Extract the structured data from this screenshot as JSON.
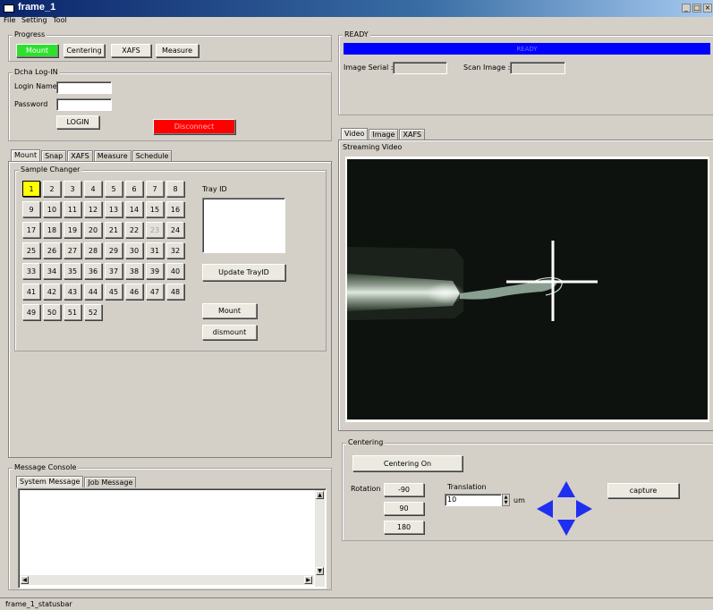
{
  "window": {
    "title": "frame_1",
    "minimize": "_",
    "maximize": "□",
    "close": "×"
  },
  "menu": [
    "File",
    "Setting",
    "Tool"
  ],
  "progress": {
    "legend": "Progress",
    "steps": [
      "Mount",
      "Centering",
      "XAFS",
      "Measure"
    ],
    "active_color": "#2ee02e"
  },
  "login": {
    "legend": "Dcha Log-IN",
    "login_name_label": "Login Name",
    "password_label": "Password",
    "login_value": "",
    "password_value": "",
    "login_button": "LOGIN",
    "disconnect_button": "Disconnect",
    "disconnect_color": "#ff0000"
  },
  "left_tabs": [
    "Mount",
    "Snap",
    "XAFS",
    "Measure",
    "Schedule"
  ],
  "sample_changer": {
    "legend": "Sample Changer",
    "cells": [
      "1",
      "2",
      "3",
      "4",
      "5",
      "6",
      "7",
      "8",
      "9",
      "10",
      "11",
      "12",
      "13",
      "14",
      "15",
      "16",
      "17",
      "18",
      "19",
      "20",
      "21",
      "22",
      "23",
      "24",
      "25",
      "26",
      "27",
      "28",
      "29",
      "30",
      "31",
      "32",
      "33",
      "34",
      "35",
      "36",
      "37",
      "38",
      "39",
      "40",
      "41",
      "42",
      "43",
      "44",
      "45",
      "46",
      "47",
      "48",
      "49",
      "50",
      "51",
      "52"
    ],
    "selected": "1",
    "disabled": "23",
    "tray_id_label": "Tray ID",
    "tray_id_value": "",
    "update_button": "Update TrayID",
    "mount_button": "Mount",
    "dismount_button": "dismount"
  },
  "console": {
    "legend": "Message Console",
    "tabs": [
      "System Message",
      "Job Message"
    ],
    "text": ""
  },
  "ready": {
    "legend": "READY",
    "bar_text": "READY",
    "bar_color": "#0000ff",
    "image_serial_label": "Image Serial :",
    "image_serial_value": "",
    "scan_image_label": "Scan Image :",
    "scan_image_value": ""
  },
  "right_tabs": [
    "Video",
    "Image",
    "XAFS"
  ],
  "video": {
    "legend": "Streaming Video"
  },
  "centering": {
    "legend": "Centering",
    "centering_on_button": "Centering On",
    "rotation_label": "Rotation",
    "rotation_buttons": [
      "-90",
      "90",
      "180"
    ],
    "translation_label": "Translation",
    "translation_value": "10",
    "unit_label": "um",
    "capture_button": "capture",
    "arrow_color": "#1f2ff0"
  },
  "statusbar": {
    "text": "frame_1_statusbar"
  }
}
